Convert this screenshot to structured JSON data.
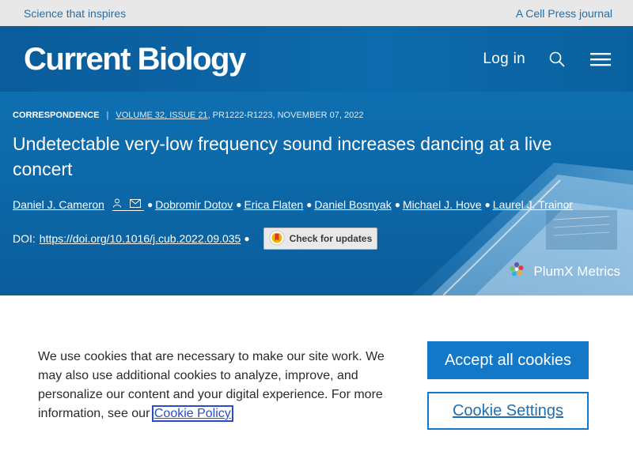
{
  "topbar": {
    "left_link": "Science that inspires",
    "right_link": "A Cell Press journal"
  },
  "header": {
    "logo": "Current Biology",
    "login": "Log in",
    "search_icon": "search-icon",
    "menu_icon": "hamburger-menu-icon"
  },
  "article": {
    "type": "CORRESPONDENCE",
    "separator": "|",
    "volume": "VOLUME 32, ISSUE 21",
    "pages_date": ", PR1222-R1223, NOVEMBER 07, 2022",
    "title": "Undetectable very-low frequency sound increases dancing at a live concert",
    "authors": [
      "Daniel J. Cameron",
      "Dobromir Dotov",
      "Erica Flaten",
      "Daniel Bosnyak",
      "Michael J. Hove",
      "Laurel J. Trainor"
    ],
    "doi_label": "DOI:",
    "doi": "https://doi.org/10.1016/j.cub.2022.09.035",
    "check_updates": "Check for updates",
    "plumx": "PlumX Metrics"
  },
  "cookie": {
    "text": "We use cookies that are necessary to make our site work. We may also use additional cookies to analyze, improve, and personalize our content and your digital experience. For more information, see our",
    "policy_link": "Cookie Policy",
    "accept": "Accept all cookies",
    "settings": "Cookie Settings"
  },
  "colors": {
    "brand_blue": "#0d6aac",
    "button_blue": "#1478c8",
    "link_blue": "#1f6fb0",
    "topbar_bg": "#e8e8e8"
  }
}
